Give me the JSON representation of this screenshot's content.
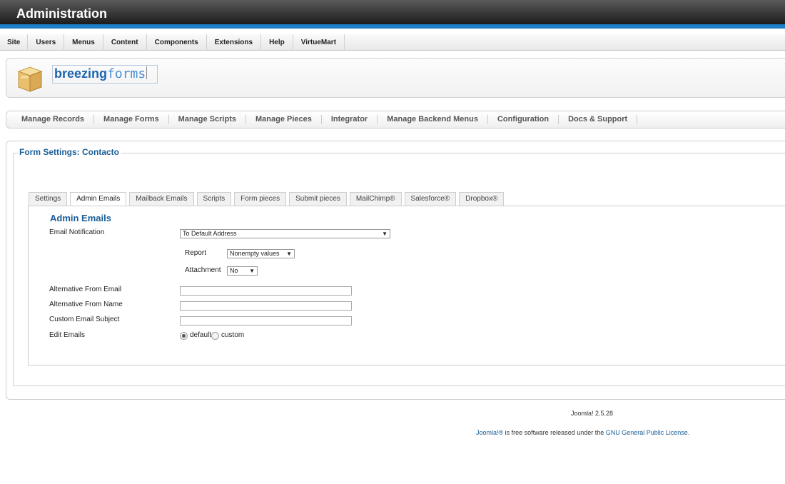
{
  "header": {
    "title": "Administration"
  },
  "menu": [
    "Site",
    "Users",
    "Menus",
    "Content",
    "Components",
    "Extensions",
    "Help",
    "VirtueMart"
  ],
  "brand": {
    "bold": "breezing",
    "light": "forms"
  },
  "subnav": [
    "Manage Records",
    "Manage Forms",
    "Manage Scripts",
    "Manage Pieces",
    "Integrator",
    "Manage Backend Menus",
    "Configuration",
    "Docs & Support"
  ],
  "panel": {
    "legend": "Form Settings: Contacto"
  },
  "tabs": [
    "Settings",
    "Admin Emails",
    "Mailback Emails",
    "Scripts",
    "Form pieces",
    "Submit pieces",
    "MailChimp®",
    "Salesforce®",
    "Dropbox®"
  ],
  "active_tab": "Admin Emails",
  "form": {
    "title": "Admin Emails",
    "email_notification_label": "Email Notification",
    "email_notification_value": "To Default Address",
    "report_label": "Report",
    "report_value": "Nonempty values",
    "attachment_label": "Attachment",
    "attachment_value": "No",
    "alt_from_email_label": "Alternative From Email",
    "alt_from_email_value": "",
    "alt_from_name_label": "Alternative From Name",
    "alt_from_name_value": "",
    "custom_subject_label": "Custom Email Subject",
    "custom_subject_value": "",
    "edit_emails_label": "Edit Emails",
    "edit_default_label": "default",
    "edit_custom_label": "custom",
    "edit_selected": "default"
  },
  "footer": {
    "version": "Joomla! 2.5.28",
    "license_link1": "Joomla!®",
    "license_text": " is free software released under the ",
    "license_link2": "GNU General Public License."
  }
}
